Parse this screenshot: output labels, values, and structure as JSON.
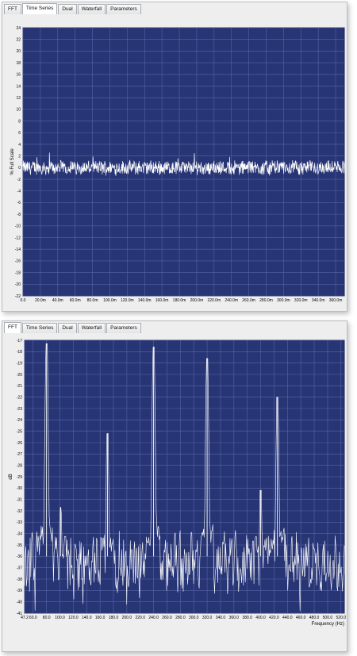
{
  "tabs": [
    "FFT",
    "Time Series",
    "Dual",
    "Waterfall",
    "Parameters"
  ],
  "top_panel": {
    "active_tab": 1
  },
  "bottom_panel": {
    "active_tab": 0
  },
  "colors": {
    "plot_bg": "#283575",
    "grid": "#5463a8",
    "trace": "#ffffff"
  },
  "chart_data": [
    {
      "type": "line",
      "title": "",
      "xlabel": "",
      "ylabel": "% Full Scale",
      "xlim": [
        0,
        0.37
      ],
      "ylim": [
        -22,
        24
      ],
      "x_ticks": [
        "0.0",
        "20.0m",
        "40.0m",
        "60.0m",
        "80.0m",
        "100.0m",
        "120.0m",
        "140.0m",
        "160.0m",
        "180.0m",
        "200.0m",
        "220.0m",
        "240.0m",
        "260.0m",
        "280.0m",
        "300.0m",
        "320.0m",
        "340.0m",
        "360.0m"
      ],
      "y_ticks": [
        24,
        22,
        20,
        18,
        16,
        14,
        12,
        10,
        8,
        6,
        4,
        2,
        0,
        -2,
        -4,
        -6,
        -8,
        -10,
        -12,
        -14,
        -16,
        -18,
        -20,
        -22
      ],
      "grid": true,
      "series": [
        {
          "values_description_mean": 0.0,
          "noise_band": [
            -1.2,
            1.6
          ]
        }
      ]
    },
    {
      "type": "line",
      "title": "",
      "xlabel": "Frequency (Hz)",
      "ylabel": "dB",
      "xlim": [
        47.2,
        525
      ],
      "ylim": [
        -41,
        -17
      ],
      "x_ticks": [
        "47.2",
        "60.0",
        "80.0",
        "100.0",
        "120.0",
        "140.0",
        "160.0",
        "180.0",
        "200.0",
        "220.0",
        "240.0",
        "260.0",
        "280.0",
        "300.0",
        "320.0",
        "340.0",
        "360.0",
        "380.0",
        "400.0",
        "420.0",
        "440.0",
        "460.0",
        "480.0",
        "500.0",
        "520.0"
      ],
      "y_ticks": [
        -17,
        -18,
        -19,
        -20,
        -21,
        -22,
        -23,
        -24,
        -25,
        -26,
        -27,
        -28,
        -29,
        -30,
        -31,
        -32,
        -33,
        -34,
        -35,
        -36,
        -37,
        -38,
        -39,
        -40,
        -41
      ],
      "grid": true,
      "series": [
        {
          "noise_floor_db": [
            -38,
            -35
          ],
          "peaks": [
            {
              "x": 80,
              "y": -17.3
            },
            {
              "x": 101,
              "y": -31.7
            },
            {
              "x": 171,
              "y": -25.2
            },
            {
              "x": 240,
              "y": -17.6
            },
            {
              "x": 320,
              "y": -18.6
            },
            {
              "x": 400,
              "y": -30.2
            },
            {
              "x": 425,
              "y": -22.0
            }
          ]
        }
      ]
    }
  ]
}
